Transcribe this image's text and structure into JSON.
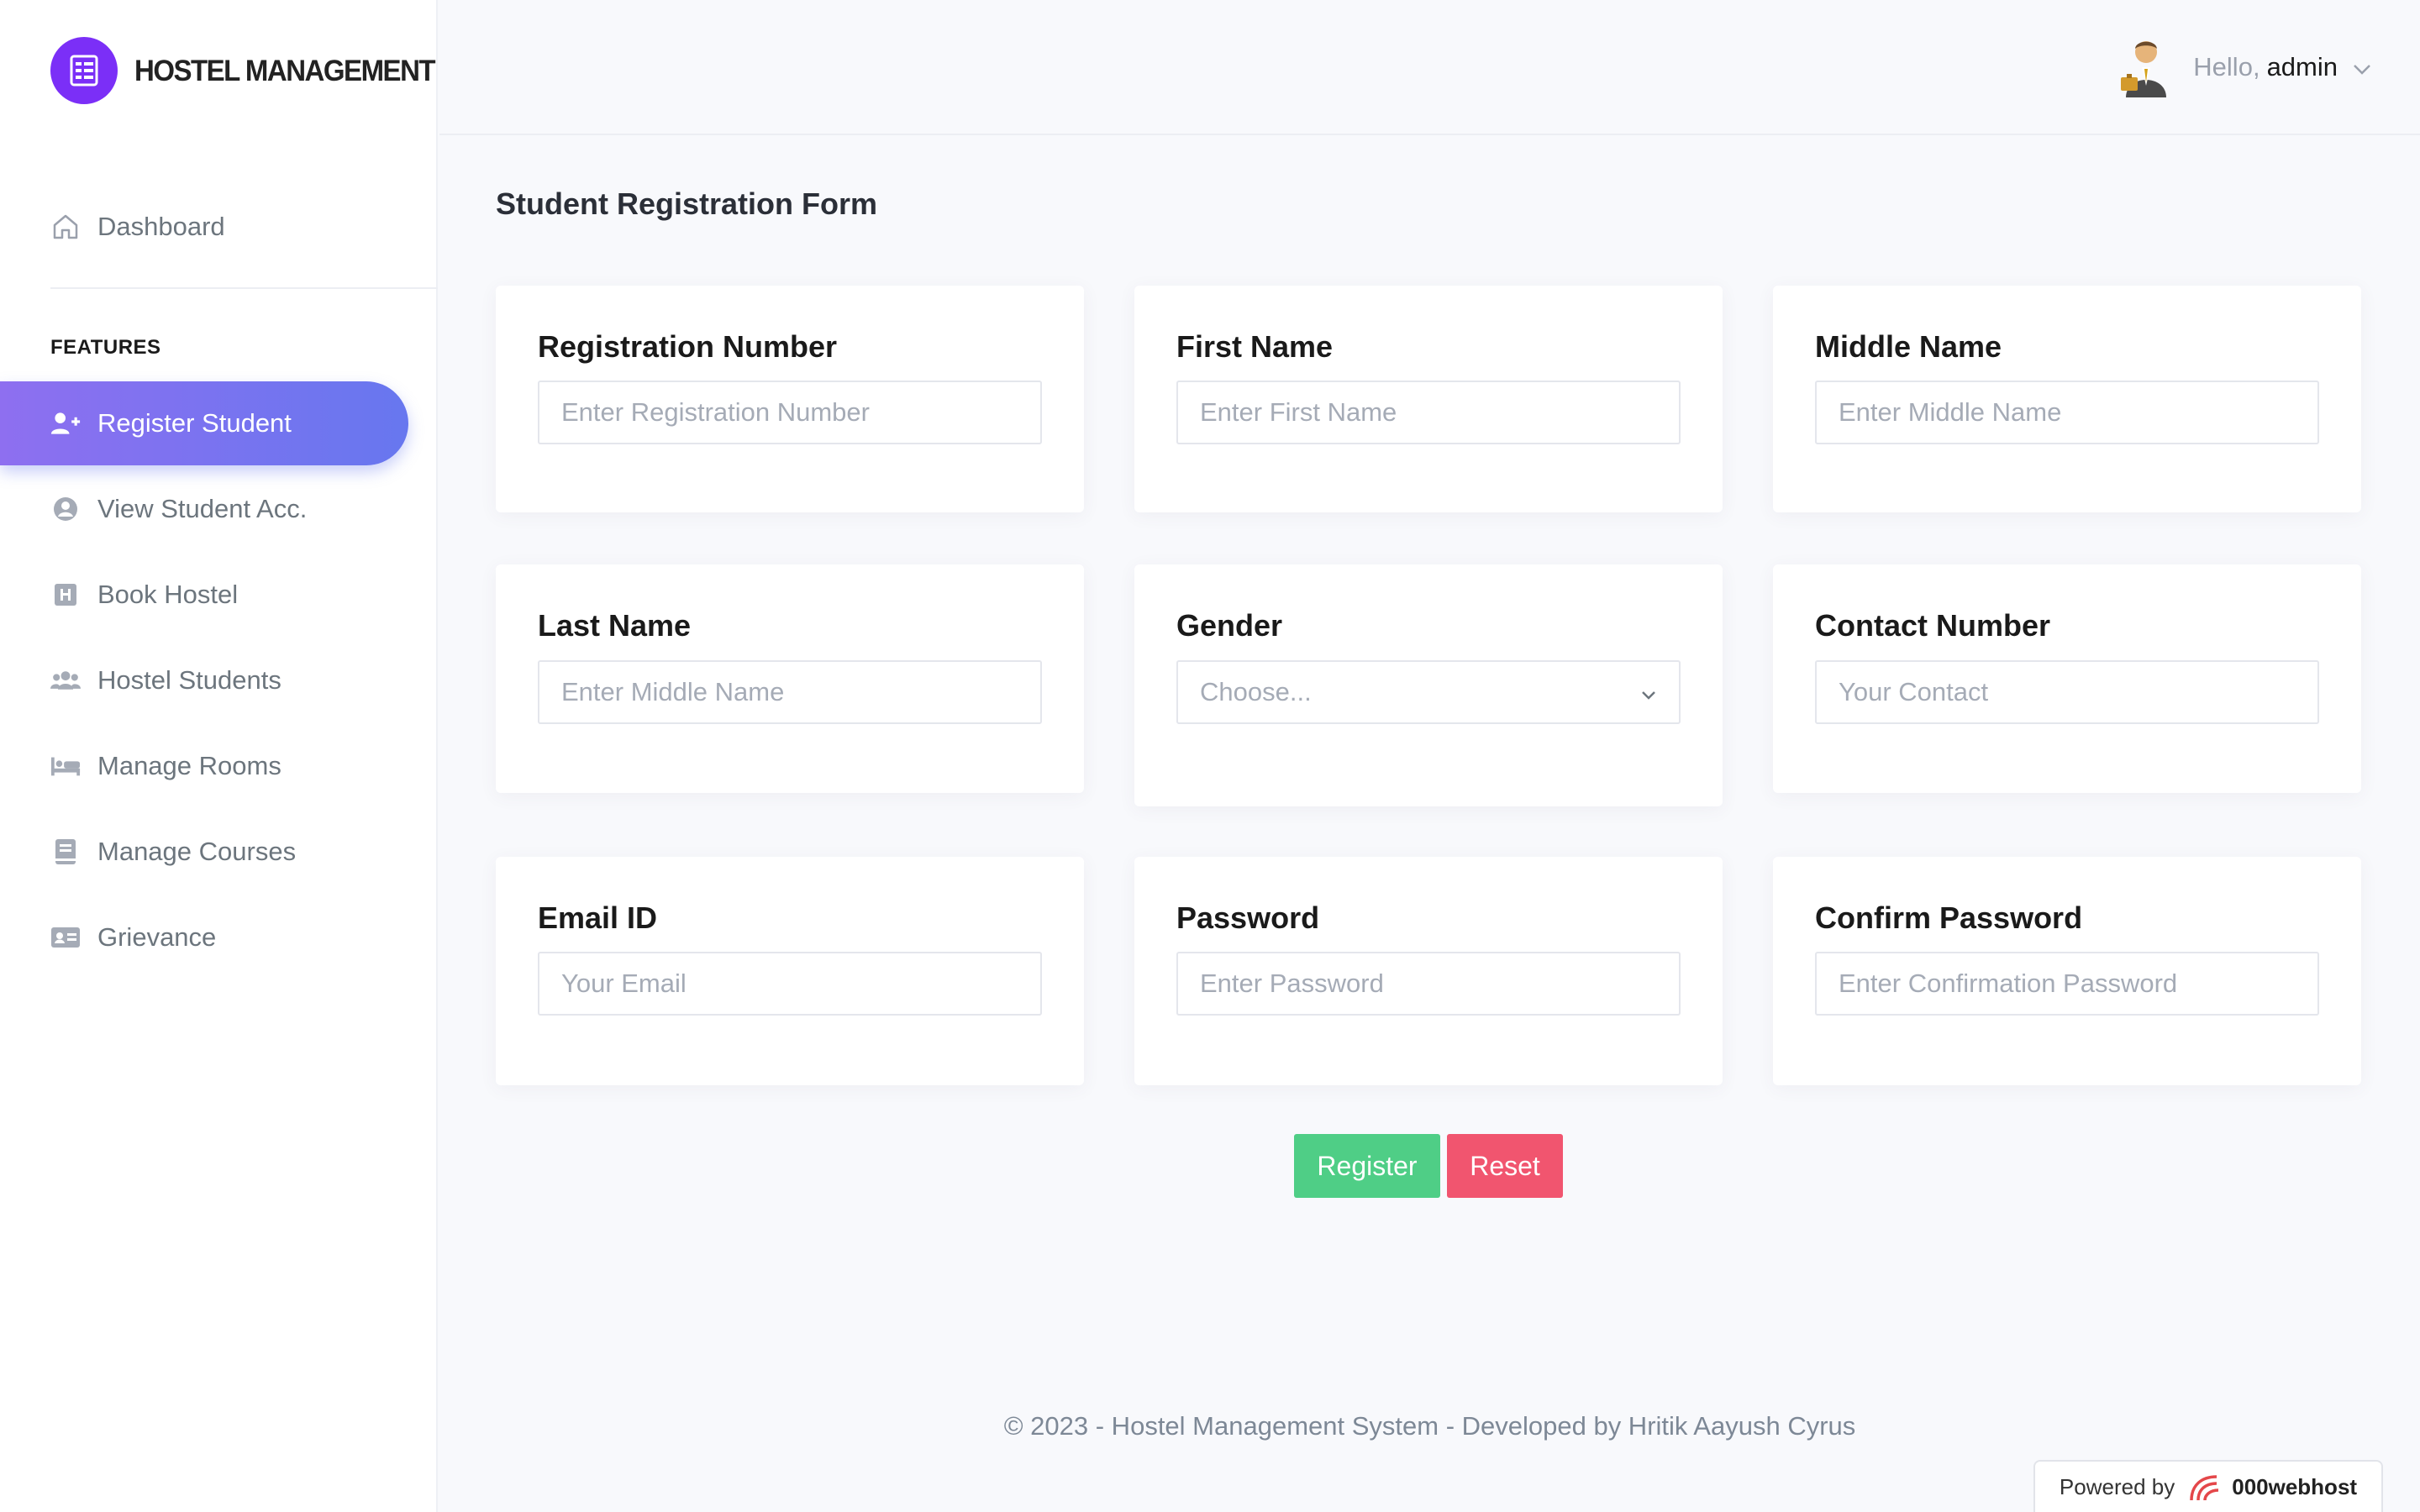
{
  "brand": {
    "name": "HOSTEL MANAGEMENT"
  },
  "sidebar": {
    "dashboard": "Dashboard",
    "section_title": "FEATURES",
    "items": [
      {
        "label": "Register Student",
        "icon": "user-plus-icon",
        "active": true
      },
      {
        "label": "View Student Acc.",
        "icon": "user-circle-icon",
        "active": false
      },
      {
        "label": "Book Hostel",
        "icon": "hotel-icon",
        "active": false
      },
      {
        "label": "Hostel Students",
        "icon": "users-icon",
        "active": false
      },
      {
        "label": "Manage Rooms",
        "icon": "bed-icon",
        "active": false
      },
      {
        "label": "Manage Courses",
        "icon": "book-icon",
        "active": false
      },
      {
        "label": "Grievance",
        "icon": "id-card-icon",
        "active": false
      }
    ]
  },
  "topbar": {
    "hello": "Hello,",
    "username": "admin"
  },
  "form": {
    "title": "Student Registration Form",
    "fields": {
      "registration": {
        "label": "Registration Number",
        "placeholder": "Enter Registration Number"
      },
      "first_name": {
        "label": "First Name",
        "placeholder": "Enter First Name"
      },
      "middle_name": {
        "label": "Middle Name",
        "placeholder": "Enter Middle Name"
      },
      "last_name": {
        "label": "Last Name",
        "placeholder": "Enter Middle Name"
      },
      "gender": {
        "label": "Gender",
        "selected": "Choose..."
      },
      "contact": {
        "label": "Contact Number",
        "placeholder": "Your Contact"
      },
      "email": {
        "label": "Email ID",
        "placeholder": "Your Email"
      },
      "password": {
        "label": "Password",
        "placeholder": "Enter Password"
      },
      "confirm_password": {
        "label": "Confirm Password",
        "placeholder": "Enter Confirmation Password"
      }
    },
    "register_label": "Register",
    "reset_label": "Reset"
  },
  "footer": {
    "text": "© 2023 - Hostel Management System - Developed by Hritik Aayush Cyrus",
    "powered_by": "Powered by",
    "powered_brand": "000webhost"
  },
  "colors": {
    "accent": "#6777ef",
    "accent_start": "#8e6ff0",
    "register": "#4fce86",
    "reset": "#f1556f",
    "logo": "#7b2ff7"
  }
}
